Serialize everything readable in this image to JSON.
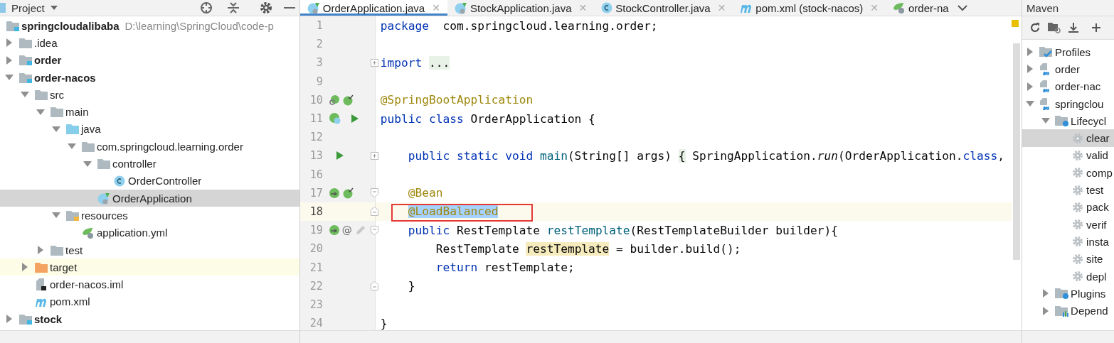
{
  "project_panel": {
    "title": "Project",
    "root": {
      "name": "springcloudalibaba",
      "path": "D:\\learning\\SpringCloud\\code-p"
    },
    "items": [
      {
        "name": ".idea",
        "kind": "folder",
        "bold": false,
        "selected": false,
        "expanded": false
      },
      {
        "name": "order",
        "kind": "module",
        "bold": true,
        "selected": false,
        "expanded": false
      },
      {
        "name": "order-nacos",
        "kind": "module",
        "bold": true,
        "selected": false,
        "expanded": true,
        "children": [
          {
            "name": "src",
            "kind": "folder",
            "bold": false,
            "selected": false,
            "expanded": true,
            "children": [
              {
                "name": "main",
                "kind": "folder",
                "bold": false,
                "selected": false,
                "expanded": true,
                "children": [
                  {
                    "name": "java",
                    "kind": "source",
                    "bold": false,
                    "selected": false,
                    "expanded": true,
                    "children": [
                      {
                        "name": "com.springcloud.learning.order",
                        "kind": "package",
                        "bold": false,
                        "selected": false,
                        "expanded": true,
                        "children": [
                          {
                            "name": "controller",
                            "kind": "package",
                            "bold": false,
                            "selected": false,
                            "expanded": true,
                            "children": [
                              {
                                "name": "OrderController",
                                "kind": "class",
                                "bold": false,
                                "selected": false
                              }
                            ]
                          },
                          {
                            "name": "OrderApplication",
                            "kind": "spring-class",
                            "bold": false,
                            "selected": true
                          }
                        ]
                      }
                    ]
                  },
                  {
                    "name": "resources",
                    "kind": "resources",
                    "bold": false,
                    "selected": false,
                    "expanded": true,
                    "children": [
                      {
                        "name": "application.yml",
                        "kind": "yml",
                        "bold": false,
                        "selected": false
                      }
                    ]
                  }
                ]
              },
              {
                "name": "test",
                "kind": "folder",
                "bold": false,
                "selected": false,
                "expanded": false
              }
            ]
          },
          {
            "name": "target",
            "kind": "excluded",
            "bold": false,
            "selected": false,
            "expanded": false
          },
          {
            "name": "order-nacos.iml",
            "kind": "iml",
            "bold": false,
            "selected": false
          },
          {
            "name": "pom.xml",
            "kind": "maven",
            "bold": false,
            "selected": false
          }
        ]
      },
      {
        "name": "stock",
        "kind": "module",
        "bold": true,
        "selected": false,
        "expanded": false
      }
    ]
  },
  "editor": {
    "tabs": [
      {
        "label": "OrderApplication.java",
        "kind": "spring-class",
        "selected": true,
        "close": "✕"
      },
      {
        "label": "StockApplication.java",
        "kind": "spring-class",
        "selected": false,
        "close": "✕"
      },
      {
        "label": "StockController.java",
        "kind": "class",
        "selected": false,
        "close": "✕"
      },
      {
        "label": "pom.xml (stock-nacos)",
        "kind": "maven",
        "selected": false,
        "close": "✕"
      },
      {
        "label": "order-na",
        "kind": "yml",
        "selected": false
      }
    ],
    "lines": [
      {
        "number": "1",
        "current": false,
        "tokens": [
          {
            "text": "package",
            "kind": "kw"
          },
          {
            "text": "  com.springcloud.learning.order;",
            "kind": "plain"
          }
        ]
      },
      {
        "number": "2",
        "current": false
      },
      {
        "number": "3",
        "current": false,
        "fold": {
          "kind": "plus"
        },
        "tokens": [
          {
            "text": "import ",
            "kind": "kw"
          },
          {
            "text": "...",
            "kind": "folded"
          }
        ]
      },
      {
        "number": "9",
        "current": false
      },
      {
        "number": "10",
        "current": false,
        "gutter": [
          {
            "kind": "bean-search"
          },
          {
            "kind": "bean-check"
          }
        ],
        "tokens": [
          {
            "text": "@SpringBootApplication",
            "kind": "ann"
          }
        ]
      },
      {
        "number": "11",
        "current": false,
        "gutter": [
          {
            "kind": "bean-class"
          },
          {
            "kind": "run"
          }
        ],
        "tokens": [
          {
            "text": "public class",
            "kind": "kw"
          },
          {
            "text": " OrderApplication {",
            "kind": "plain"
          }
        ]
      },
      {
        "number": "12",
        "current": false
      },
      {
        "number": "13",
        "current": false,
        "fold": {
          "kind": "plus"
        },
        "gutter": [
          {
            "kind": "run"
          }
        ],
        "tokens": [
          {
            "text": "    public static void ",
            "kind": "kw"
          },
          {
            "text": "main",
            "kind": "fn"
          },
          {
            "text": "(String[] args) ",
            "kind": "plain"
          },
          {
            "text": "{",
            "kind": "folded"
          },
          {
            "text": " SpringApplication.",
            "kind": "plain"
          },
          {
            "text": "run",
            "kind": "italic"
          },
          {
            "text": "(OrderApplication.",
            "kind": "plain"
          },
          {
            "text": "class",
            "kind": "kw"
          },
          {
            "text": ",",
            "kind": "plain"
          }
        ]
      },
      {
        "number": "16",
        "current": false
      },
      {
        "number": "17",
        "current": false,
        "fold": {
          "kind": "start"
        },
        "gutter": [
          {
            "kind": "bean-nav"
          },
          {
            "kind": "bean-check"
          }
        ],
        "tokens": [
          {
            "text": "    @Bean",
            "kind": "ann"
          }
        ]
      },
      {
        "number": "18",
        "current": true,
        "callout": true,
        "fold": {
          "kind": "end"
        },
        "tokens": [
          {
            "text": "    @LoadBalanced",
            "kind": "ann-selected"
          }
        ]
      },
      {
        "number": "19",
        "current": false,
        "fold": {
          "kind": "start"
        },
        "gutter": [
          {
            "kind": "bean-nav"
          },
          {
            "kind": "text",
            "text": "@"
          },
          {
            "kind": "edit"
          }
        ],
        "tokens": [
          {
            "text": "    public",
            "kind": "kw"
          },
          {
            "text": " RestTemplate ",
            "kind": "plain"
          },
          {
            "text": "restTemplate",
            "kind": "fn"
          },
          {
            "text": "(RestTemplateBuilder builder){",
            "kind": "plain"
          }
        ]
      },
      {
        "number": "20",
        "current": false,
        "tokens": [
          {
            "text": "        RestTemplate ",
            "kind": "plain"
          },
          {
            "text": "restTemplate",
            "kind": "usage"
          },
          {
            "text": " = builder.build();",
            "kind": "plain"
          }
        ]
      },
      {
        "number": "21",
        "current": false,
        "tokens": [
          {
            "text": "        return",
            "kind": "kw"
          },
          {
            "text": " restTemplate;",
            "kind": "plain"
          }
        ]
      },
      {
        "number": "22",
        "current": false,
        "fold": {
          "kind": "end"
        },
        "tokens": [
          {
            "text": "    }",
            "kind": "plain"
          }
        ]
      },
      {
        "number": "23",
        "current": false
      },
      {
        "number": "24",
        "current": false,
        "tokens": [
          {
            "text": "}",
            "kind": "plain"
          }
        ]
      }
    ]
  },
  "maven_panel": {
    "title": "Maven",
    "items": [
      {
        "name": "Profiles",
        "kind": "profiles",
        "selected": false,
        "expanded": false
      },
      {
        "name": "order",
        "kind": "project",
        "selected": false,
        "expanded": false
      },
      {
        "name": "order-nac",
        "kind": "project",
        "selected": false,
        "expanded": false
      },
      {
        "name": "springclou",
        "kind": "project",
        "selected": false,
        "expanded": true,
        "children": [
          {
            "name": "Lifecycl",
            "kind": "lifecycle",
            "selected": false,
            "expanded": true,
            "children": [
              {
                "name": "clear",
                "kind": "goal",
                "selected": true
              },
              {
                "name": "valid",
                "kind": "goal",
                "selected": false
              },
              {
                "name": "comp",
                "kind": "goal",
                "selected": false
              },
              {
                "name": "test",
                "kind": "goal",
                "selected": false
              },
              {
                "name": "pack",
                "kind": "goal",
                "selected": false
              },
              {
                "name": "verif",
                "kind": "goal",
                "selected": false
              },
              {
                "name": "insta",
                "kind": "goal",
                "selected": false
              },
              {
                "name": "site",
                "kind": "goal",
                "selected": false
              },
              {
                "name": "depl",
                "kind": "goal",
                "selected": false
              }
            ]
          },
          {
            "name": "Plugins",
            "kind": "plugins",
            "selected": false,
            "expanded": false
          },
          {
            "name": "Depend",
            "kind": "dependencies",
            "selected": false,
            "expanded": false
          }
        ]
      }
    ]
  }
}
